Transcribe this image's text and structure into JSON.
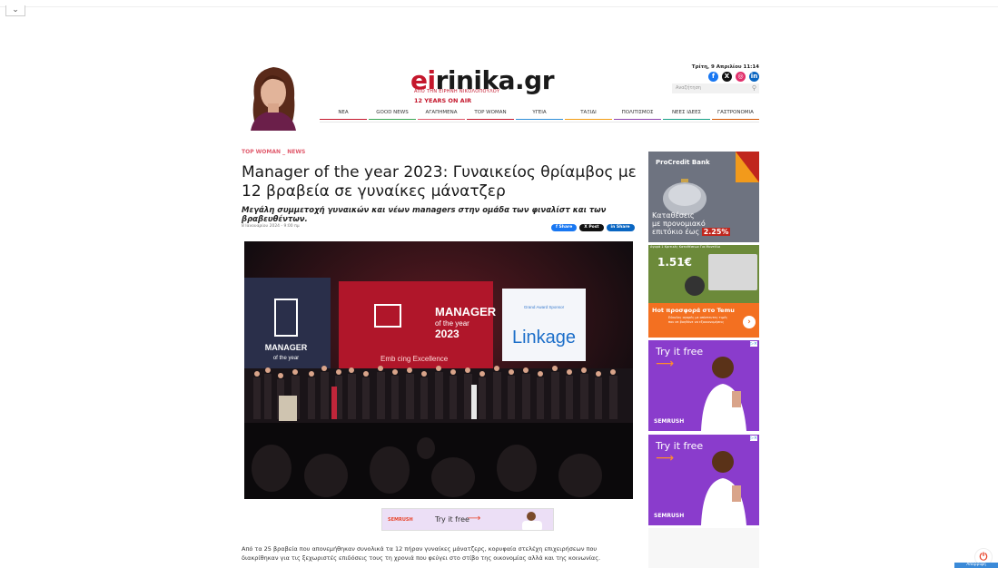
{
  "header": {
    "logo_ei": "ei",
    "logo_rest": "rinika.gr",
    "logo_sub": "ΑΠΟ ΤΗΝ ΕΙΡΗΝΗ ΝΙΚΟΛΟΠΟΥΛΟΥ",
    "logo_years": "12 YEARS ON AIR",
    "date": "Τρίτη, 9 Απριλίου 11:14",
    "search_placeholder": "Αναζήτηση",
    "socials": [
      {
        "icon": "facebook-icon",
        "glyph": "f",
        "color": "#1877f2"
      },
      {
        "icon": "x-icon",
        "glyph": "X",
        "color": "#111111"
      },
      {
        "icon": "instagram-icon",
        "glyph": "◎",
        "color": "#e1306c"
      },
      {
        "icon": "linkedin-icon",
        "glyph": "in",
        "color": "#0a66c2"
      }
    ],
    "nav": [
      {
        "label": "ΝΕΑ",
        "color": "#c4172c"
      },
      {
        "label": "GOOD NEWS",
        "color": "#3aa655"
      },
      {
        "label": "ΑΓΑΠΗΜΕΝΑ",
        "color": "#e05a6c"
      },
      {
        "label": "TOP WOMAN",
        "color": "#c4172c"
      },
      {
        "label": "ΥΓΕΙΑ",
        "color": "#2f8ed8"
      },
      {
        "label": "ΤΑΞΙΔΙ",
        "color": "#f39c12"
      },
      {
        "label": "ΠΟΛΙΤΙΣΜΟΣ",
        "color": "#8e44ad"
      },
      {
        "label": "ΝΕΕΣ ΙΔΕΕΣ",
        "color": "#16a085"
      },
      {
        "label": "ΓΑΣΤΡΟΝΟΜΙΑ",
        "color": "#d35400"
      }
    ]
  },
  "article": {
    "category": "TOP WOMAN",
    "category_sep": " _ ",
    "category2": "NEWS",
    "title": "Manager of the year 2023: Γυναικείος θρίαμβος με 12 βραβεία σε γυναίκες μάνατζερ",
    "subtitle": "Μεγάλη συμμετοχή γυναικών και νέων managers στην ομάδα των φιναλίστ και των βραβευθέντων.",
    "meta": "8 Ιανουαρίου 2024 - 9:00 πμ",
    "shares": [
      {
        "label": "f Share",
        "color": "#1877f2"
      },
      {
        "label": "X Post",
        "color": "#111111"
      },
      {
        "label": "in Share",
        "color": "#0a66c2"
      }
    ],
    "hero_screen_left_1": "MANAGER",
    "hero_screen_left_2": "of the year",
    "hero_screen_main_1": "MANAGER",
    "hero_screen_main_2": "of the year",
    "hero_screen_main_3": "2023",
    "hero_screen_main_4": "Emb  cing Excellence",
    "hero_sponsor_label": "Grand Award Sponsor",
    "hero_sponsor": "Linkage",
    "body": "Από τα 25 βραβεία που απονεμήθηκαν συνολικά τα 12 πήραν γυναίκες μάνατζερς, κορυφαία στελέχη επιχειρήσεων που διακρίθηκαν για τις ξεχωριστές επιδόσεις τους τη χρονιά που φεύγει στο στίβο της οικονομίας αλλά και της κοινωνίας."
  },
  "banner": {
    "logo": "SEMRUSH",
    "text": "Try it free",
    "arrow": "⟶"
  },
  "sidebar": {
    "ad1_logo": "ProCredit Bank",
    "ad1_text_1": "Καταθέσεις",
    "ad1_text_2": "με προνομιακό",
    "ad1_text_3": "επιτόκιο έως",
    "ad1_rate": "2.25%",
    "ad2_head": "Αγορά 1 Κριτικές Καταθέσεων Για Μοντέλα",
    "ad2_price": "1.51€",
    "ad2_title": "Hot προσφορά στο Temu",
    "ad2_desc": "Εύκολες αγορές με απίστευτες τιμές που σε βοηθάνε να εξοικονομήσεις",
    "ad2_go": "›",
    "ad3_try": "Try it free",
    "ad3_logo": "SEMRUSH",
    "ad4_try": "Try it free",
    "ad4_logo": "SEMRUSH",
    "arrow": "⟶",
    "ad_x": "▷×"
  },
  "chrome": {
    "collapse": "⌄",
    "fab": "⏻",
    "denied": "Απόρριψη"
  }
}
